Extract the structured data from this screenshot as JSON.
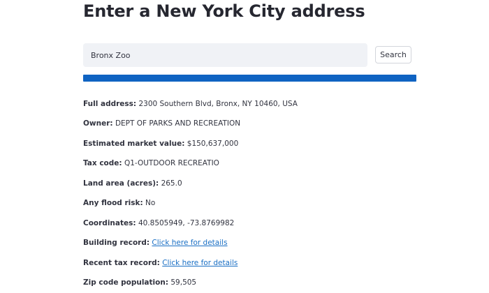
{
  "page": {
    "title": "Enter a New York City address"
  },
  "search": {
    "value": "Bronx Zoo",
    "placeholder": "",
    "button_label": "Search"
  },
  "progress": {
    "percent": 100,
    "color": "#0f63c2"
  },
  "details": {
    "full_address": {
      "label": "Full address",
      "value": "2300 Southern Blvd, Bronx, NY 10460, USA"
    },
    "owner": {
      "label": "Owner",
      "value": "DEPT OF PARKS AND RECREATION"
    },
    "market_value": {
      "label": "Estimated market value",
      "value": "$150,637,000"
    },
    "tax_code": {
      "label": "Tax code",
      "value": "Q1-OUTDOOR RECREATIO"
    },
    "land_area": {
      "label": "Land area (acres)",
      "value": "265.0"
    },
    "flood_risk": {
      "label": "Any flood risk",
      "value": "No"
    },
    "coordinates": {
      "label": "Coordinates",
      "value": "40.8505949, -73.8769982"
    },
    "building_record": {
      "label": "Building record",
      "link_text": "Click here for details"
    },
    "tax_record": {
      "label": "Recent tax record",
      "link_text": "Click here for details"
    },
    "zip_population": {
      "label": "Zip code population",
      "value": "59,505"
    }
  },
  "colors": {
    "link": "#1a6fc4",
    "input_background": "#f0f2f6",
    "text": "#31333f"
  }
}
